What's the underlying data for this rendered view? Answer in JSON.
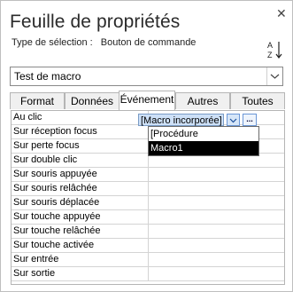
{
  "window": {
    "title": "Feuille de propriétés",
    "close_glyph": "✕"
  },
  "selection": {
    "label": "Type de sélection :",
    "value": "Bouton de commande"
  },
  "sort_icon": "sort-az-icon",
  "object_combo": {
    "value": "Test de macro"
  },
  "tabs": [
    {
      "label": "Format"
    },
    {
      "label": "Données"
    },
    {
      "label": "Événement"
    },
    {
      "label": "Autres"
    },
    {
      "label": "Toutes"
    }
  ],
  "active_tab": "Événement",
  "properties": [
    {
      "label": "Au clic",
      "value": "[Macro incorporée]"
    },
    {
      "label": "Sur réception focus",
      "value": ""
    },
    {
      "label": "Sur perte focus",
      "value": ""
    },
    {
      "label": "Sur double clic",
      "value": ""
    },
    {
      "label": "Sur souris appuyée",
      "value": ""
    },
    {
      "label": "Sur souris relâchée",
      "value": ""
    },
    {
      "label": "Sur souris déplacée",
      "value": ""
    },
    {
      "label": "Sur touche appuyée",
      "value": ""
    },
    {
      "label": "Sur touche relâchée",
      "value": ""
    },
    {
      "label": "Sur touche activée",
      "value": ""
    },
    {
      "label": "Sur entrée",
      "value": ""
    },
    {
      "label": "Sur sortie",
      "value": ""
    }
  ],
  "builder_button": {
    "glyph": "..."
  },
  "dropdown_options": [
    {
      "label": "[Procédure événementielle]"
    },
    {
      "label": "Macro1"
    }
  ],
  "selected_option": "Macro1",
  "colors": {
    "selection_highlight": "#000000",
    "active_cell": "#cde0f7"
  }
}
